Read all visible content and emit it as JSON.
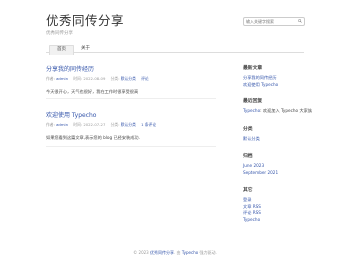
{
  "header": {
    "site_title": "优秀同传分享",
    "site_desc": "优秀同传分享"
  },
  "search": {
    "placeholder": "输入关键字搜索"
  },
  "nav": [
    {
      "label": "首页"
    },
    {
      "label": "关于"
    }
  ],
  "posts": [
    {
      "title": "分享我的同传经历",
      "author_label": "作者:",
      "author": "admin",
      "time_label": "时间:",
      "time": "2022-08-09",
      "category_label": "分类:",
      "category": "默认分类",
      "comments": "评论",
      "excerpt": "今天很开心，天气也很好，我在工作时很享受很高"
    },
    {
      "title": "欢迎使用 Typecho",
      "author_label": "作者:",
      "author": "admin",
      "time_label": "时间:",
      "time": "2022-07-27",
      "category_label": "分类:",
      "category": "默认分类",
      "comments": "1 条评论",
      "excerpt": "如果您看到这篇文章,表示您的 blog 已经安装成功."
    }
  ],
  "sidebar": {
    "recent_posts": {
      "title": "最新文章",
      "items": [
        "分享我的同传经历",
        "欢迎使用 Typecho"
      ]
    },
    "recent_comments": {
      "title": "最近回复",
      "items": [
        {
          "author": "Typecho",
          "text": "欢迎加入 Typecho 大家族"
        }
      ]
    },
    "categories": {
      "title": "分类",
      "items": [
        "默认分类"
      ]
    },
    "archives": {
      "title": "归档",
      "items": [
        "June 2023",
        "September 2021"
      ]
    },
    "others": {
      "title": "其它",
      "items": [
        "登录",
        "文章 RSS",
        "评论 RSS",
        "Typecho"
      ]
    }
  },
  "footer": {
    "prefix": "© 2023",
    "site_link": "优秀同传分享",
    "middle": ". 由",
    "engine_link": "Typecho",
    "suffix": "强力驱动."
  }
}
